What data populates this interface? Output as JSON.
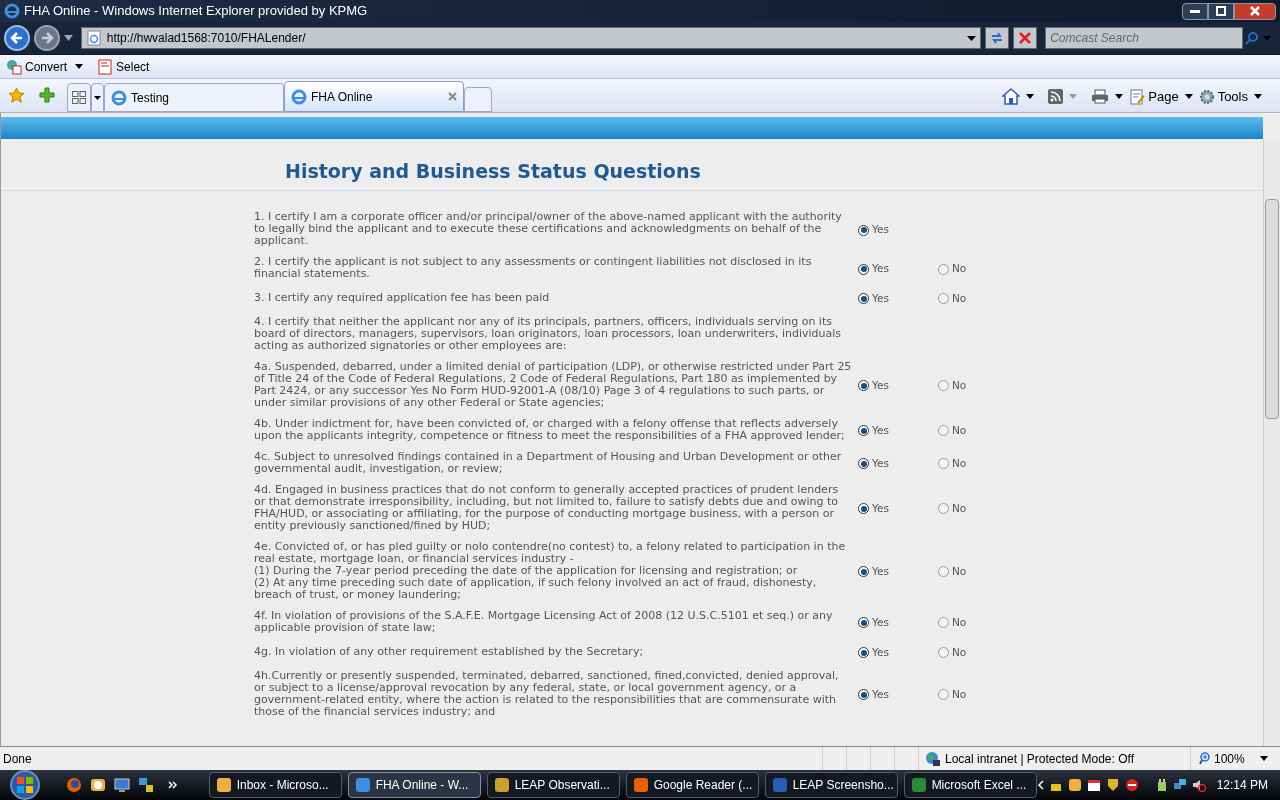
{
  "window": {
    "title": "FHA Online - Windows Internet Explorer provided by KPMG"
  },
  "address_bar": {
    "url": "http://hwvalad1568:7010/FHALender/"
  },
  "search": {
    "placeholder": "Comcast Search"
  },
  "command_bar": {
    "items": [
      "Convert",
      "Select"
    ]
  },
  "tabs": [
    {
      "label": "Testing",
      "selected": false
    },
    {
      "label": "FHA Online",
      "selected": true
    }
  ],
  "toolbar": {
    "items": [
      "Page",
      "Tools"
    ]
  },
  "page": {
    "heading": "History and Business Status Questions",
    "questions": [
      {
        "text": "1. I certify I am a corporate officer and/or principal/owner of the above-named applicant with the authority to legally bind the applicant and to execute these certifications and acknowledgments on behalf of the applicant.",
        "options": [
          {
            "label": "Yes",
            "selected": true
          }
        ]
      },
      {
        "text": "2. I certify the applicant is not subject to any assessments or contingent liabilities not disclosed in its financial statements.",
        "options": [
          {
            "label": "Yes",
            "selected": true
          },
          {
            "label": "No",
            "selected": false
          }
        ]
      },
      {
        "text": "3. I certify any required application fee has been paid",
        "options": [
          {
            "label": "Yes",
            "selected": true
          },
          {
            "label": "No",
            "selected": false
          }
        ]
      },
      {
        "text": "4. I certify that neither the applicant nor any of its principals, partners, officers, individuals serving on its board of directors, managers, supervisors, loan originators, loan processors, loan underwriters, individuals acting as authorized signatories or other employees are:"
      },
      {
        "text": "4a. Suspended, debarred, under a limited denial of participation (LDP), or otherwise restricted under Part 25 of Title 24 of the Code of Federal Regulations, 2 Code of Federal Regulations, Part 180 as implemented by Part 2424, or any successor Yes No Form HUD-92001-A (08/10) Page 3 of 4 regulations to such parts, or under similar provisions of any other Federal or State agencies;",
        "options": [
          {
            "label": "Yes",
            "selected": true
          },
          {
            "label": "No",
            "selected": false
          }
        ]
      },
      {
        "text": "4b. Under indictment for, have been convicted of, or charged with a felony offense that reflects adversely upon the applicants integrity, competence or fitness to meet the responsibilities of a FHA approved lender;",
        "options": [
          {
            "label": "Yes",
            "selected": true
          },
          {
            "label": "No",
            "selected": false
          }
        ]
      },
      {
        "text": "4c. Subject to unresolved findings contained in a Department of Housing and Urban Development or other governmental audit, investigation, or review;",
        "options": [
          {
            "label": "Yes",
            "selected": true
          },
          {
            "label": "No",
            "selected": false
          }
        ]
      },
      {
        "text": "4d. Engaged in business practices that do not conform to generally accepted practices of prudent lenders or that demonstrate irresponsibility, including, but not limited to, failure to satisfy debts due and owing to FHA/HUD, or associating or affiliating, for the purpose of conducting mortgage business, with a person or entity previously sanctioned/fined by HUD;",
        "options": [
          {
            "label": "Yes",
            "selected": true
          },
          {
            "label": "No",
            "selected": false
          }
        ]
      },
      {
        "text": "4e. Convicted of, or has pled guilty or nolo contendre(no contest) to, a felony related to participation in the real estate, mortgage loan, or financial services industry -\n(1) During the 7-year period preceding the date of the application for licensing and registration; or\n(2) At any time preceding such date of application, if such felony involved an act of fraud, dishonesty, breach of trust, or money laundering;",
        "options": [
          {
            "label": "Yes",
            "selected": true
          },
          {
            "label": "No",
            "selected": false
          }
        ]
      },
      {
        "text": "4f. In violation of provisions of the S.A.F.E. Mortgage Licensing Act of 2008 (12 U.S.C.5101 et seq.) or any applicable provision of state law;",
        "options": [
          {
            "label": "Yes",
            "selected": true
          },
          {
            "label": "No",
            "selected": false
          }
        ]
      },
      {
        "text": "4g. In violation of any other requirement established by the Secretary;",
        "options": [
          {
            "label": "Yes",
            "selected": true
          },
          {
            "label": "No",
            "selected": false
          }
        ]
      },
      {
        "text": "4h.Currently or presently suspended, terminated, debarred, sanctioned, fined,convicted, denied approval, or subject to a license/approval revocation by any federal, state, or local government agency, or a government-related entity, where the action is related to the responsibilities that are commensurate with those of the financial services industry; and",
        "options": [
          {
            "label": "Yes",
            "selected": true
          },
          {
            "label": "No",
            "selected": false
          }
        ]
      }
    ]
  },
  "status_bar": {
    "text": "Done",
    "zone": "Local intranet | Protected Mode: Off",
    "zoom": "100%"
  },
  "taskbar": {
    "items": [
      {
        "label": "Inbox - Microso...",
        "selected": false
      },
      {
        "label": "FHA Online - W...",
        "selected": true
      },
      {
        "label": "LEAP Observati...",
        "selected": false
      },
      {
        "label": "Google Reader (...",
        "selected": false
      },
      {
        "label": "LEAP Screensho...",
        "selected": false
      },
      {
        "label": "Microsoft Excel ...",
        "selected": false
      }
    ],
    "clock": "12:14 PM"
  }
}
